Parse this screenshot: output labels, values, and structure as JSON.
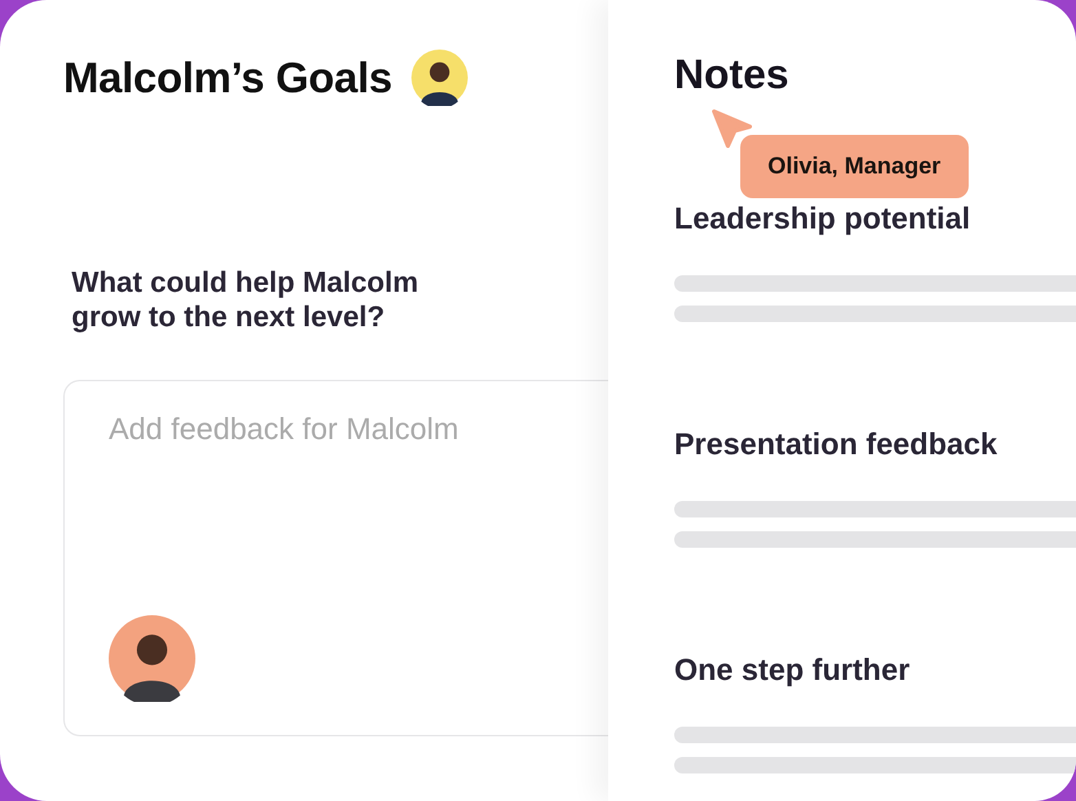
{
  "goals": {
    "title": "Malcolm’s Goals",
    "question": "What could help Malcolm grow to the next level?",
    "feedback": {
      "placeholder": "Add feedback for Malcolm"
    }
  },
  "notes": {
    "title": "Notes",
    "cursor": {
      "label": "Olivia, Manager"
    },
    "sections": [
      {
        "heading": "Leadership potential"
      },
      {
        "heading": "Presentation feedback"
      },
      {
        "heading": "One step further"
      }
    ]
  }
}
